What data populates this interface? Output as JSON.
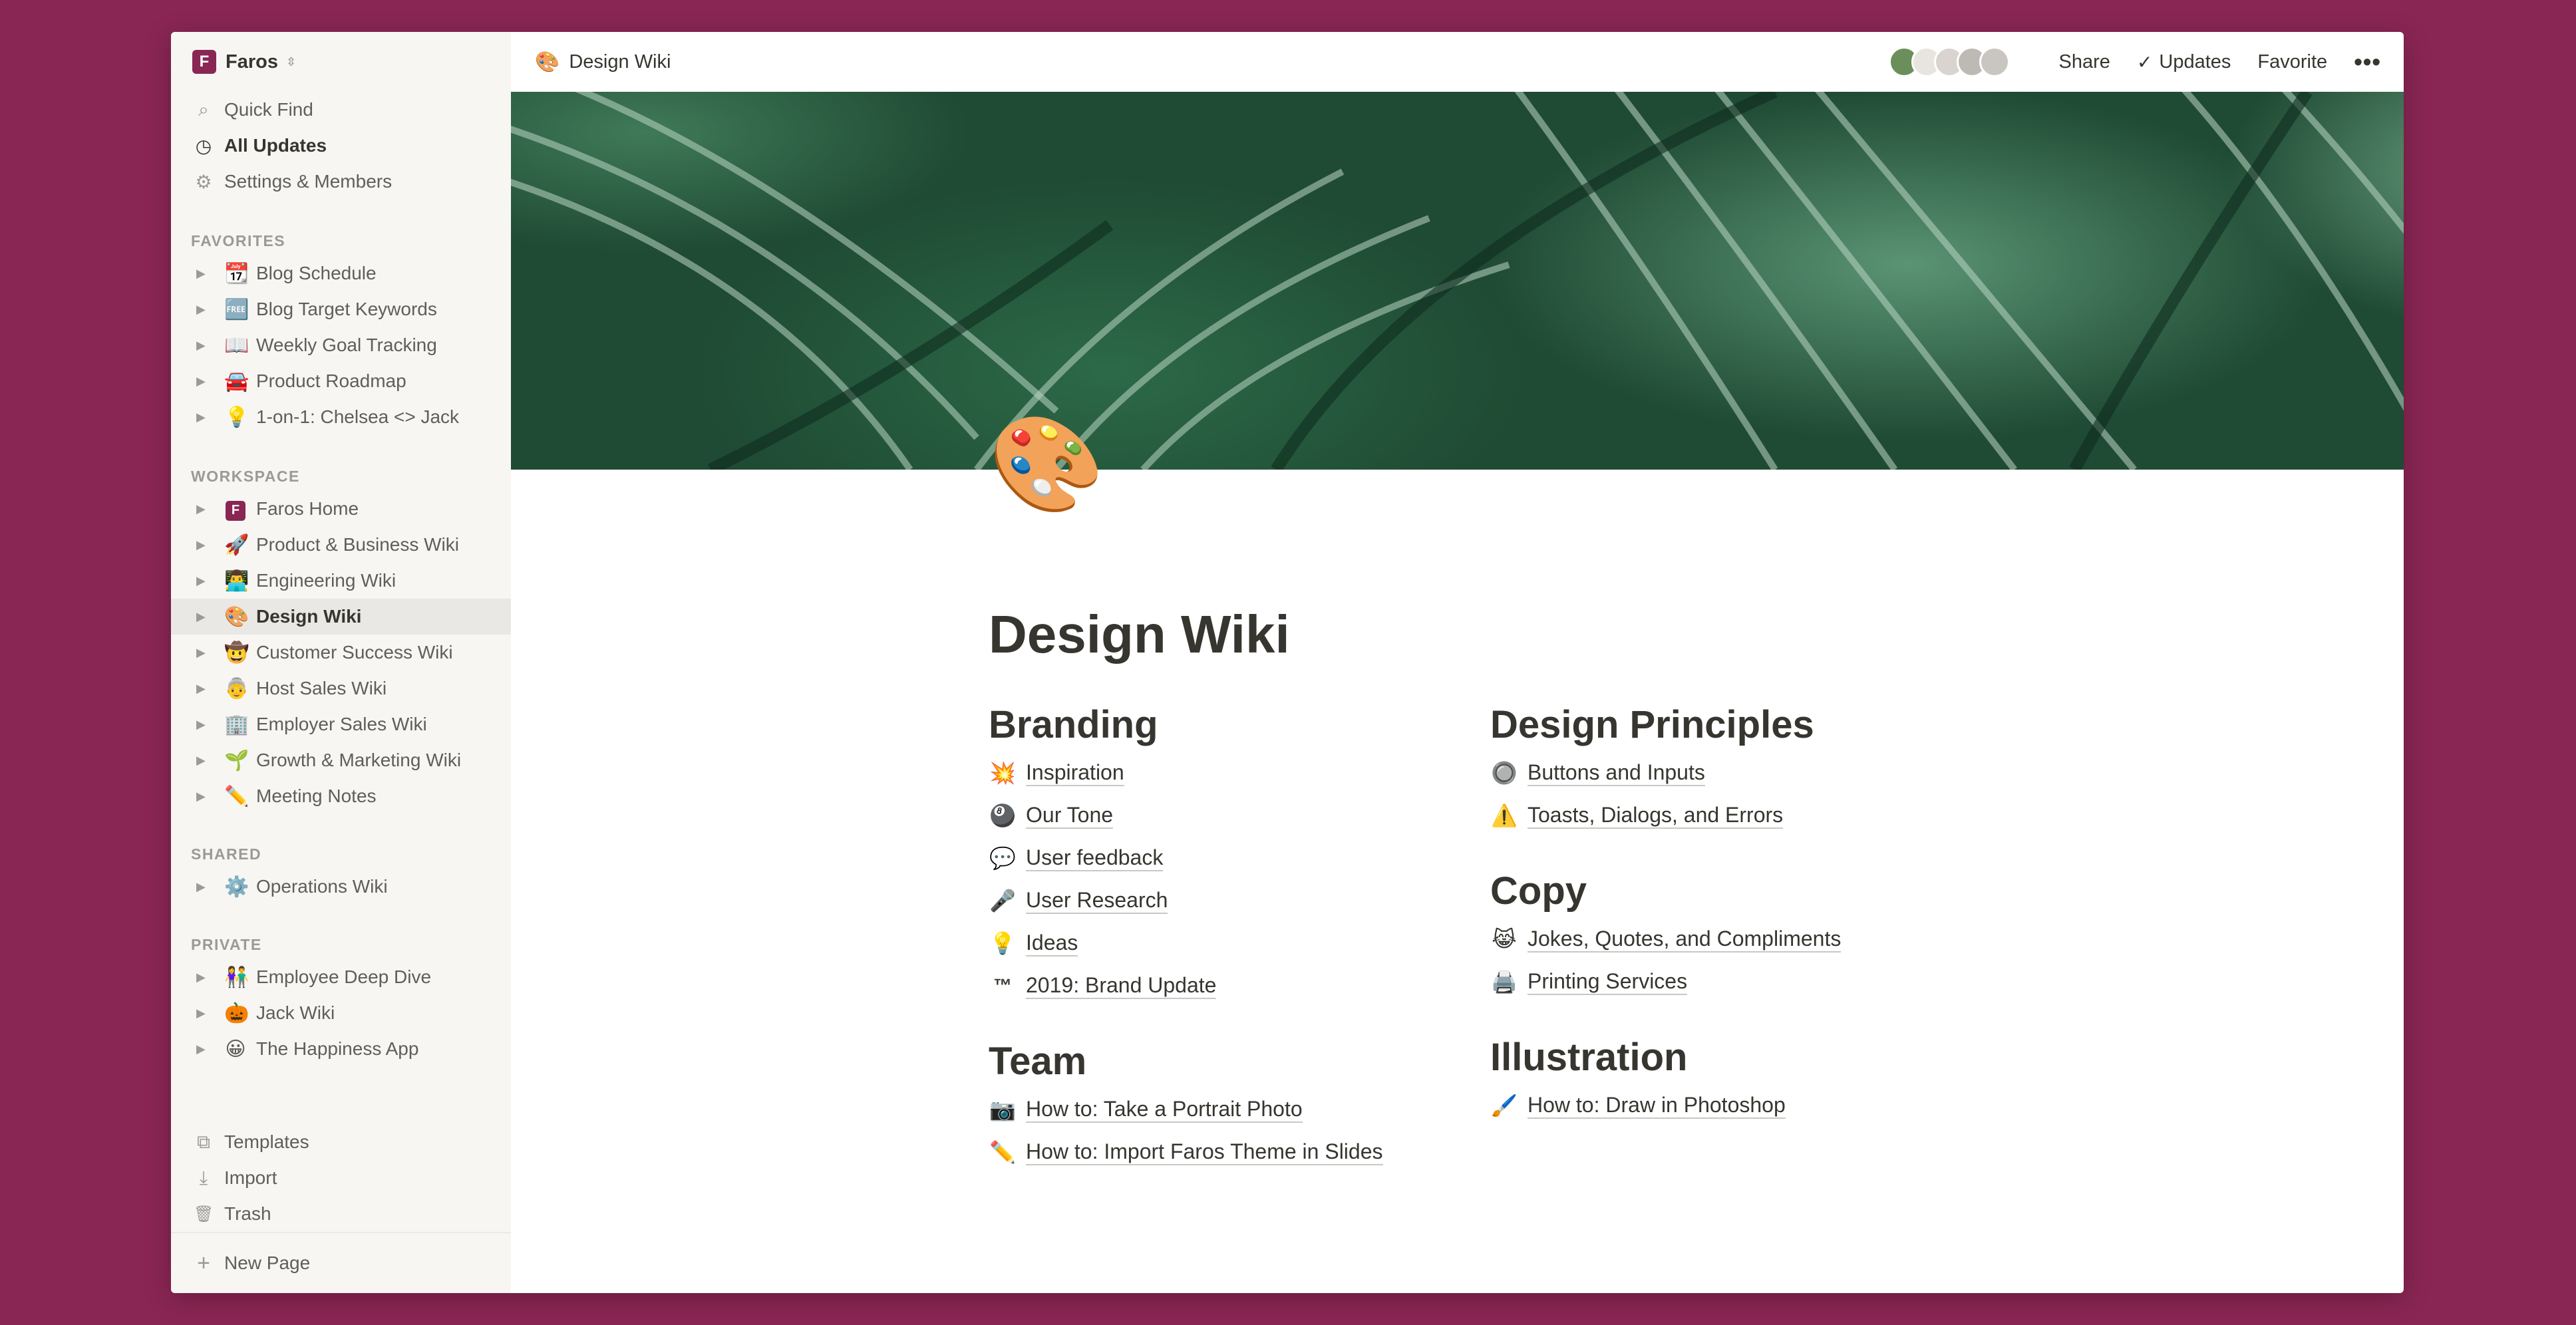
{
  "workspace": {
    "name": "Faros",
    "logo_letter": "F"
  },
  "sidebar": {
    "top_nav": [
      {
        "label": "Quick Find",
        "icon": "search-icon",
        "glyph": "⌕"
      },
      {
        "label": "All Updates",
        "icon": "clock-icon",
        "glyph": "◷"
      },
      {
        "label": "Settings & Members",
        "icon": "gear-icon",
        "glyph": "⚙"
      }
    ],
    "favorites_title": "FAVORITES",
    "favorites": [
      {
        "emoji": "📆",
        "label": "Blog Schedule"
      },
      {
        "emoji": "🆓",
        "label": "Blog Target Keywords"
      },
      {
        "emoji": "📖",
        "label": "Weekly Goal Tracking"
      },
      {
        "emoji": "🚘",
        "label": "Product Roadmap"
      },
      {
        "emoji": "💡",
        "label": "1-on-1: Chelsea <> Jack"
      }
    ],
    "workspace_title": "WORKSPACE",
    "workspace_items": [
      {
        "emoji": "F",
        "label": "Faros Home"
      },
      {
        "emoji": "🚀",
        "label": "Product & Business Wiki"
      },
      {
        "emoji": "👨‍💻",
        "label": "Engineering Wiki"
      },
      {
        "emoji": "🎨",
        "label": "Design Wiki",
        "active": true
      },
      {
        "emoji": "🤠",
        "label": "Customer Success Wiki"
      },
      {
        "emoji": "👵",
        "label": "Host Sales Wiki"
      },
      {
        "emoji": "🏢",
        "label": "Employer Sales Wiki"
      },
      {
        "emoji": "🌱",
        "label": "Growth & Marketing Wiki"
      },
      {
        "emoji": "✏️",
        "label": "Meeting Notes"
      }
    ],
    "shared_title": "SHARED",
    "shared": [
      {
        "emoji": "⚙️",
        "label": "Operations Wiki"
      }
    ],
    "private_title": "PRIVATE",
    "private": [
      {
        "emoji": "👫",
        "label": "Employee Deep Dive"
      },
      {
        "emoji": "🎃",
        "label": "Jack Wiki"
      },
      {
        "emoji": "😀",
        "label": "The Happiness App"
      }
    ],
    "bottom_tools": [
      {
        "label": "Templates",
        "icon": "templates-icon",
        "glyph": "⧉"
      },
      {
        "label": "Import",
        "icon": "import-icon",
        "glyph": "⤓"
      },
      {
        "label": "Trash",
        "icon": "trash-icon",
        "glyph": "🗑"
      }
    ],
    "new_page": {
      "label": "New Page",
      "glyph": "+"
    }
  },
  "topbar": {
    "breadcrumb_emoji": "🎨",
    "breadcrumb": "Design Wiki",
    "share": "Share",
    "updates": "Updates",
    "favorite": "Favorite",
    "more": "•••",
    "avatar_colors": [
      "#6a8f5a",
      "#e8e4e0",
      "#d9d4cf",
      "#bdbab6",
      "#c9c6c2"
    ]
  },
  "page": {
    "icon": "🎨",
    "title": "Design Wiki",
    "left_column": [
      {
        "heading": "Branding",
        "links": [
          {
            "emoji": "💥",
            "label": "Inspiration"
          },
          {
            "emoji": "🎱",
            "label": "Our Tone"
          },
          {
            "emoji": "💬",
            "label": "User feedback"
          },
          {
            "emoji": "🎤",
            "label": "User Research"
          },
          {
            "emoji": "💡",
            "label": "Ideas"
          },
          {
            "emoji": "™",
            "label": "2019: Brand Update"
          }
        ]
      },
      {
        "heading": "Team",
        "links": [
          {
            "emoji": "📷",
            "label": "How to: Take a Portrait Photo"
          },
          {
            "emoji": "✏️",
            "label": "How to: Import Faros Theme in Slides"
          }
        ]
      }
    ],
    "right_column": [
      {
        "heading": "Design Principles",
        "links": [
          {
            "emoji": "🔘",
            "label": "Buttons and Inputs"
          },
          {
            "emoji": "⚠️",
            "label": "Toasts, Dialogs, and Errors"
          }
        ]
      },
      {
        "heading": "Copy",
        "links": [
          {
            "emoji": "😹",
            "label": "Jokes, Quotes, and Compliments"
          },
          {
            "emoji": "🖨️",
            "label": "Printing Services"
          }
        ]
      },
      {
        "heading": "Illustration",
        "links": [
          {
            "emoji": "🖌️",
            "label": "How to: Draw in Photoshop"
          }
        ]
      }
    ]
  }
}
